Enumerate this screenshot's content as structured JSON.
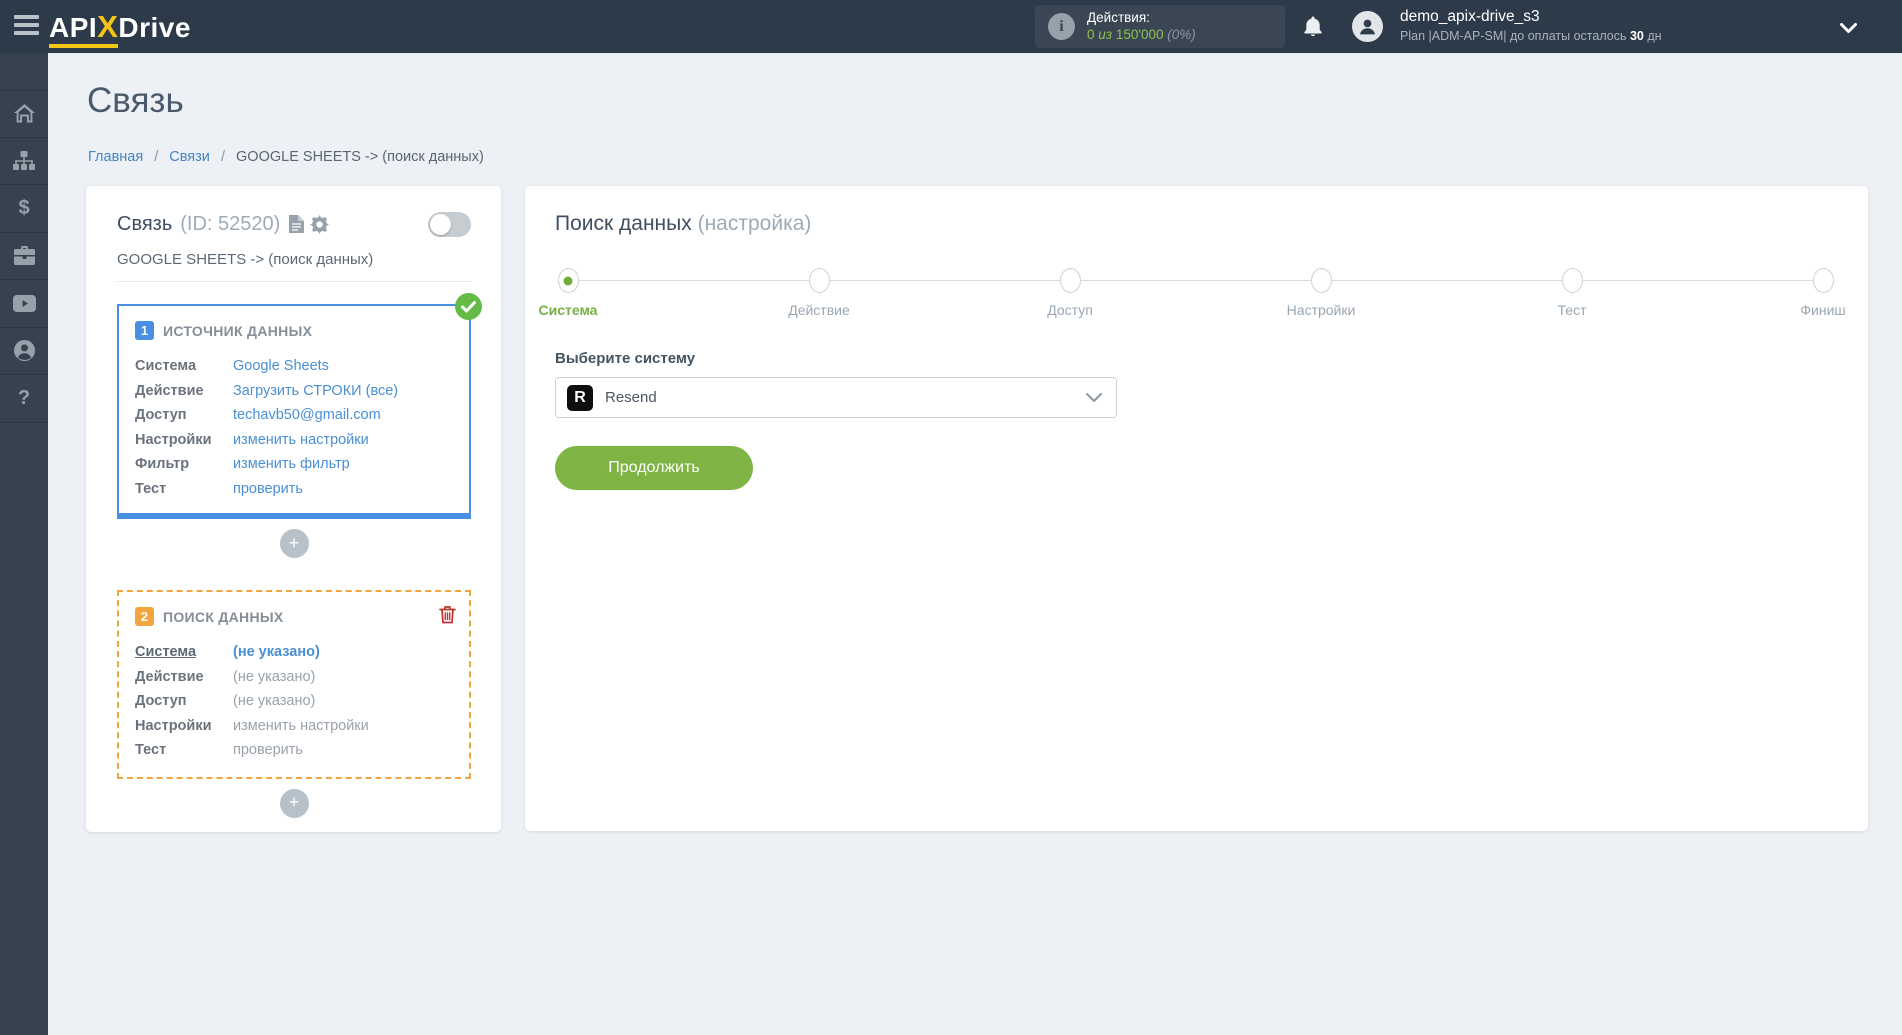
{
  "colors": {
    "header_bg": "#2d3a49",
    "accent_blue": "#4a90e2",
    "accent_green": "#7db444",
    "accent_orange": "#f2a53e",
    "accent_red": "#c5312f",
    "brand_yellow": "#f3c614"
  },
  "header": {
    "logo": {
      "part1": "API",
      "part2": "X",
      "part3": "Drive"
    },
    "actions": {
      "label": "Действия:",
      "used": "0",
      "of_word": "из",
      "total": "150'000",
      "percent": "(0%)"
    },
    "user": {
      "name": "demo_apix-drive_s3",
      "plan_prefix": "Plan |ADM-AP-SM| до оплаты осталось",
      "days": "30",
      "days_unit": "дн"
    }
  },
  "sidebar": {
    "items": [
      {
        "icon": "home-icon"
      },
      {
        "icon": "sitemap-icon"
      },
      {
        "icon": "dollar-icon",
        "glyph": "$"
      },
      {
        "icon": "briefcase-icon"
      },
      {
        "icon": "video-icon"
      },
      {
        "icon": "user-icon"
      },
      {
        "icon": "help-icon",
        "glyph": "?"
      }
    ]
  },
  "page": {
    "title": "Связь",
    "breadcrumb": {
      "home": "Главная",
      "links": "Связи",
      "current": "GOOGLE SHEETS -> (поиск данных)",
      "separator": "/"
    }
  },
  "link_card": {
    "title": "Связь",
    "id_label": "(ID: 52520)",
    "subtitle": "GOOGLE SHEETS -> (поиск данных)"
  },
  "source_block": {
    "number": "1",
    "title": "ИСТОЧНИК ДАННЫХ",
    "rows": [
      {
        "label": "Система",
        "value": "Google Sheets"
      },
      {
        "label": "Действие",
        "value": "Загрузить СТРОКИ (все)"
      },
      {
        "label": "Доступ",
        "value": "techavb50@gmail.com"
      },
      {
        "label": "Настройки",
        "value": "изменить настройки"
      },
      {
        "label": "Фильтр",
        "value": "изменить фильтр"
      },
      {
        "label": "Тест",
        "value": "проверить"
      }
    ]
  },
  "search_block": {
    "number": "2",
    "title": "ПОИСК ДАННЫХ",
    "rows": [
      {
        "label": "Система",
        "value": "(не указано)"
      },
      {
        "label": "Действие",
        "value": "(не указано)"
      },
      {
        "label": "Доступ",
        "value": "(не указано)"
      },
      {
        "label": "Настройки",
        "value": "изменить настройки"
      },
      {
        "label": "Тест",
        "value": "проверить"
      }
    ]
  },
  "add_button": {
    "label": "+"
  },
  "setup": {
    "title": "Поиск данных",
    "title_suffix": "(настройка)",
    "steps": [
      {
        "label": "Система"
      },
      {
        "label": "Действие"
      },
      {
        "label": "Доступ"
      },
      {
        "label": "Настройки"
      },
      {
        "label": "Тест"
      },
      {
        "label": "Финиш"
      }
    ],
    "select_label": "Выберите систему",
    "selected_system": "Resend",
    "system_initial": "R",
    "continue_label": "Продолжить"
  }
}
